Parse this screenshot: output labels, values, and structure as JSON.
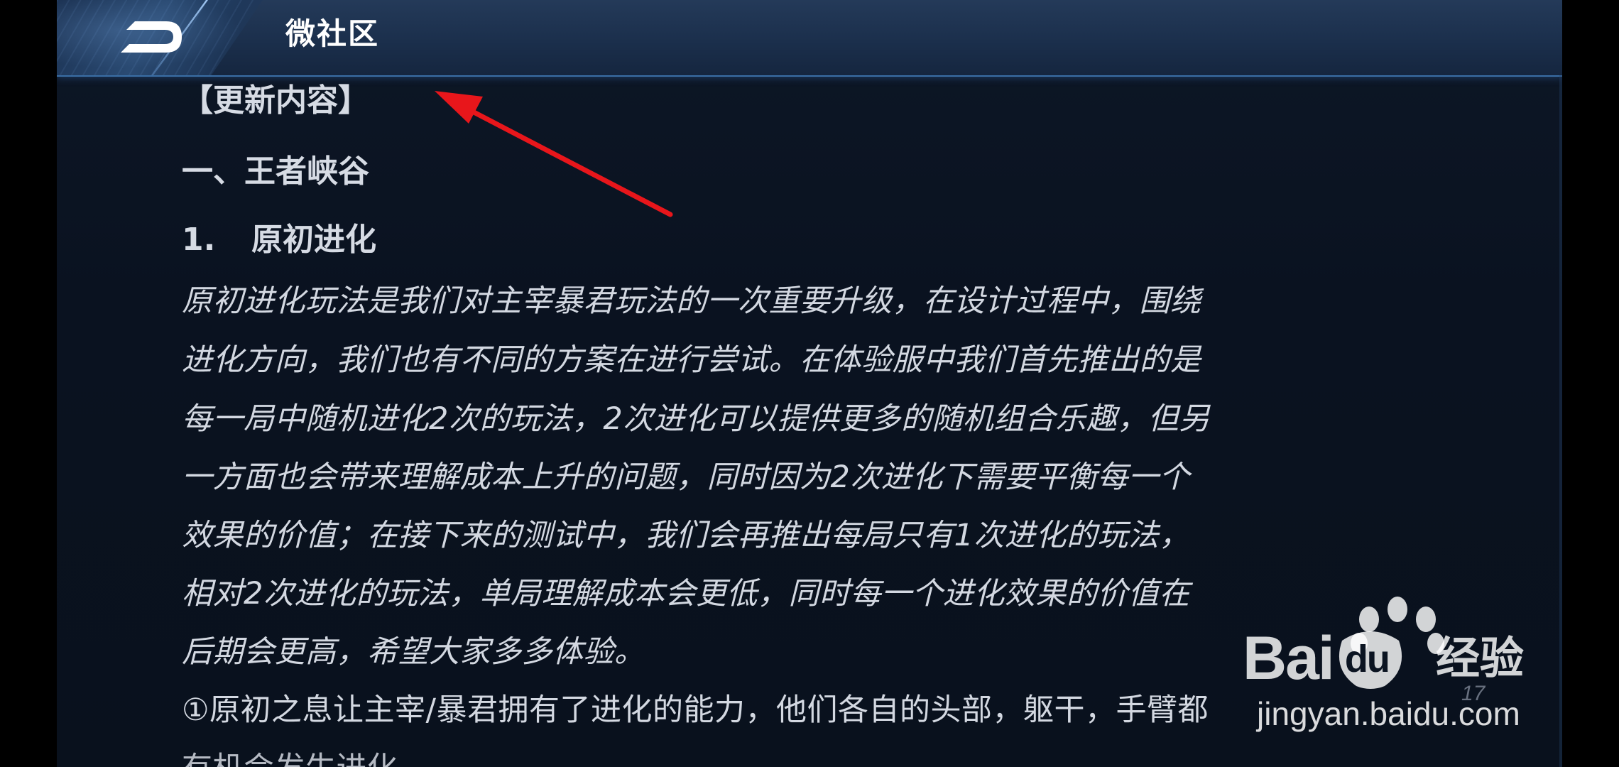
{
  "header": {
    "title": "微社区",
    "back_icon": "back-return-icon"
  },
  "article": {
    "update_heading": "【更新内容】",
    "section1_heading": "一、王者峡谷",
    "item1_number": "1.",
    "item1_title": "原初进化",
    "body_lines": [
      "原初进化玩法是我们对主宰暴君玩法的一次重要升级，在设计过程中，围绕",
      "进化方向，我们也有不同的方案在进行尝试。在体验服中我们首先推出的是",
      "每一局中随机进化2次的玩法，2次进化可以提供更多的随机组合乐趣，但另",
      "一方面也会带来理解成本上升的问题，同时因为2次进化下需要平衡每一个",
      "效果的价值；在接下来的测试中，我们会再推出每局只有1次进化的玩法，",
      "相对2次进化的玩法，单局理解成本会更低，同时每一个进化效果的价值在",
      "后期会更高，希望大家多多体验。",
      "①原初之息让主宰/暴君拥有了进化的能力，他们各自的头部，躯干，手臂都",
      "有机会发生进化"
    ]
  },
  "annotation": {
    "arrow_color": "#e8161b"
  },
  "watermark": {
    "brand_prefix": "Bai",
    "brand_du": "du",
    "brand_suffix": "经验",
    "url": "jingyan.baidu.com",
    "page_number": "17"
  },
  "colors": {
    "header_bg": "#1b2f4c",
    "panel_bg": "#0a1220",
    "text": "#d3d8e1",
    "accent_line": "#3a6ea5"
  }
}
